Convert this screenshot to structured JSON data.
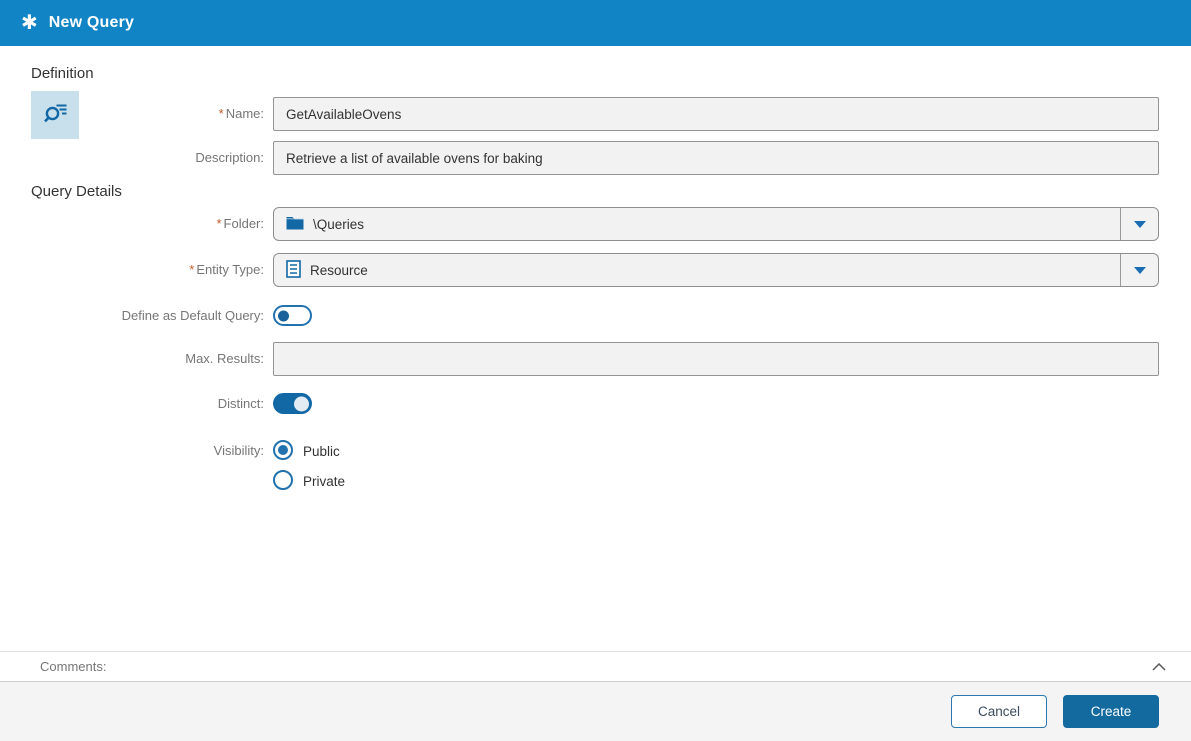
{
  "required_marker": "*",
  "header": {
    "title": "New Query"
  },
  "sections": {
    "definition": "Definition",
    "query_details": "Query Details"
  },
  "fields": {
    "name": {
      "label": "Name:",
      "required": true,
      "value": "GetAvailableOvens"
    },
    "description": {
      "label": "Description:",
      "value": "Retrieve a list of available ovens for baking"
    },
    "folder": {
      "label": "Folder:",
      "required": true,
      "value": "\\Queries"
    },
    "entity_type": {
      "label": "Entity Type:",
      "required": true,
      "value": "Resource"
    },
    "default_query": {
      "label": "Define as Default Query:",
      "state": "off"
    },
    "max_results": {
      "label": "Max. Results:",
      "value": ""
    },
    "distinct": {
      "label": "Distinct:",
      "state": "on"
    },
    "visibility": {
      "label": "Visibility:",
      "options": [
        {
          "label": "Public",
          "selected": true
        },
        {
          "label": "Private",
          "selected": false
        }
      ]
    }
  },
  "comments": {
    "label": "Comments:"
  },
  "footer": {
    "cancel_label": "Cancel",
    "create_label": "Create"
  },
  "colors": {
    "header_bg": "#1184c5",
    "accent_blue": "#1268a5",
    "create_button_bg": "#136a9f",
    "cancel_button_border": "#2b77ae",
    "required_asterisk": "#c05b28",
    "field_bg": "#f2f2f2",
    "label_text": "#767676"
  }
}
